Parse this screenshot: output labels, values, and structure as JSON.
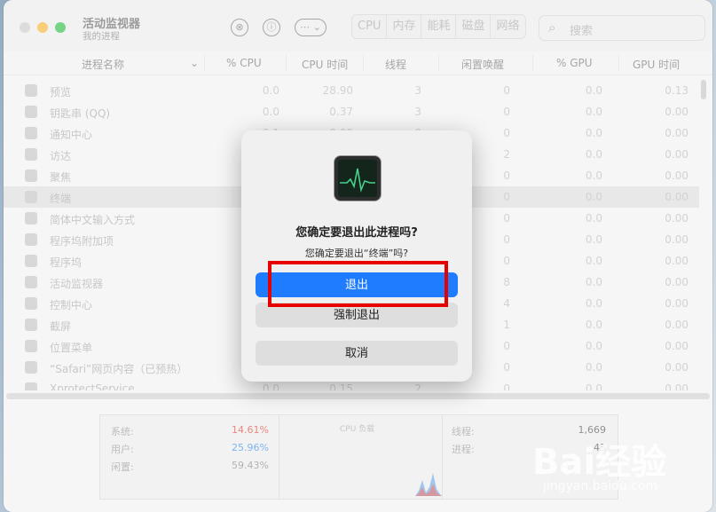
{
  "window": {
    "title": "活动监视器",
    "subtitle": "我的进程"
  },
  "toolbar": {
    "stop_icon": "⊗",
    "info_icon": "ⓘ",
    "more_icon": "⋯ ⌄"
  },
  "tabs": [
    "CPU",
    "内存",
    "能耗",
    "磁盘",
    "网络"
  ],
  "search": {
    "placeholder": "搜索"
  },
  "columns": {
    "name": "进程名称",
    "cpu_pct": "% CPU",
    "cpu_time": "CPU 时间",
    "threads": "线程",
    "idle_wakeups": "闲置唤醒",
    "gpu_pct": "% GPU",
    "gpu_time": "GPU 时间"
  },
  "rows": [
    {
      "name": "预览",
      "cpu_pct": "0.0",
      "cpu_time": "28.90",
      "threads": "3",
      "idle_wakeups": "0",
      "gpu_pct": "0.0",
      "gpu_time": "0.13"
    },
    {
      "name": "钥匙串 (QQ)",
      "cpu_pct": "0.0",
      "cpu_time": "0.37",
      "threads": "3",
      "idle_wakeups": "0",
      "gpu_pct": "0.0",
      "gpu_time": "0.00"
    },
    {
      "name": "通知中心",
      "cpu_pct": "0.1",
      "cpu_time": "0.00",
      "threads": "0",
      "idle_wakeups": "0",
      "gpu_pct": "0.0",
      "gpu_time": "0.00"
    },
    {
      "name": "访达",
      "cpu_pct": "",
      "cpu_time": "",
      "threads": "",
      "idle_wakeups": "2",
      "gpu_pct": "0.0",
      "gpu_time": "0.00"
    },
    {
      "name": "聚焦",
      "cpu_pct": "",
      "cpu_time": "",
      "threads": "",
      "idle_wakeups": "0",
      "gpu_pct": "0.0",
      "gpu_time": "0.00"
    },
    {
      "name": "终端",
      "cpu_pct": "",
      "cpu_time": "",
      "threads": "",
      "idle_wakeups": "0",
      "gpu_pct": "0.0",
      "gpu_time": "0.00",
      "selected": true
    },
    {
      "name": "简体中文输入方式",
      "cpu_pct": "",
      "cpu_time": "",
      "threads": "",
      "idle_wakeups": "0",
      "gpu_pct": "0.0",
      "gpu_time": "0.00"
    },
    {
      "name": "程序坞附加项",
      "cpu_pct": "",
      "cpu_time": "",
      "threads": "",
      "idle_wakeups": "0",
      "gpu_pct": "0.0",
      "gpu_time": "0.00"
    },
    {
      "name": "程序坞",
      "cpu_pct": "",
      "cpu_time": "",
      "threads": "",
      "idle_wakeups": "0",
      "gpu_pct": "0.0",
      "gpu_time": "0.00"
    },
    {
      "name": "活动监视器",
      "cpu_pct": "",
      "cpu_time": "",
      "threads": "",
      "idle_wakeups": "8",
      "gpu_pct": "0.0",
      "gpu_time": "0.00"
    },
    {
      "name": "控制中心",
      "cpu_pct": "",
      "cpu_time": "",
      "threads": "",
      "idle_wakeups": "4",
      "gpu_pct": "0.0",
      "gpu_time": "0.00"
    },
    {
      "name": "截屏",
      "cpu_pct": "",
      "cpu_time": "",
      "threads": "",
      "idle_wakeups": "1",
      "gpu_pct": "0.0",
      "gpu_time": "0.00"
    },
    {
      "name": "位置菜单",
      "cpu_pct": "",
      "cpu_time": "",
      "threads": "",
      "idle_wakeups": "0",
      "gpu_pct": "0.0",
      "gpu_time": "0.00"
    },
    {
      "name": "“Safari”网页内容（已预热）",
      "cpu_pct": "",
      "cpu_time": "",
      "threads": "",
      "idle_wakeups": "0",
      "gpu_pct": "0.0",
      "gpu_time": "0.00"
    },
    {
      "name": "XprotectService",
      "cpu_pct": "0.0",
      "cpu_time": "0.15",
      "threads": "2",
      "idle_wakeups": "0",
      "gpu_pct": "0.0",
      "gpu_time": "0.00"
    }
  ],
  "summary": {
    "system_label": "系统:",
    "system_value": "14.61%",
    "system_color": "#e0443a",
    "user_label": "用户:",
    "user_value": "25.96%",
    "user_color": "#3a8ee6",
    "idle_label": "闲置:",
    "idle_value": "59.43%",
    "cpu_load_label": "CPU 负载",
    "threads_label": "线程:",
    "threads_value": "1,669",
    "processes_label": "进程:",
    "processes_value": "43"
  },
  "dialog": {
    "title": "您确定要退出此进程吗?",
    "message": "您确定要退出“终端”吗?",
    "quit_label": "退出",
    "force_quit_label": "强制退出",
    "cancel_label": "取消",
    "accent_color": "#1f7cff"
  },
  "watermark": {
    "brand": "Bai经验",
    "url": "jingyan.baidu.com"
  }
}
